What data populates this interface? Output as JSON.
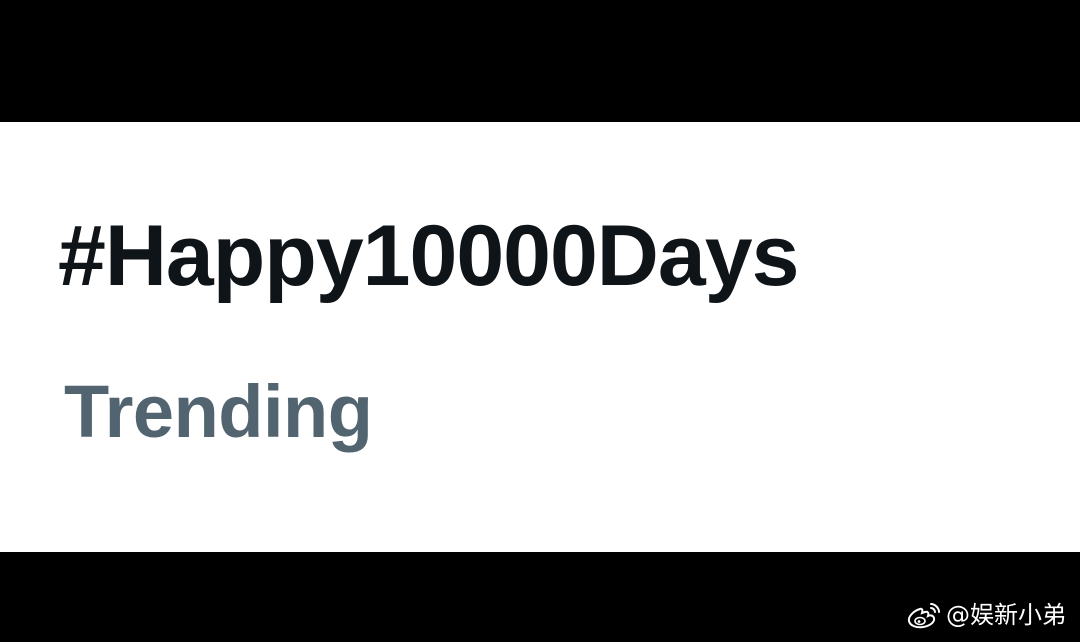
{
  "trend": {
    "hashtag": "#Happy10000Days",
    "context": "Trending"
  },
  "watermark": {
    "icon": "weibo-logo-icon",
    "handle": "@娱新小弟"
  },
  "colors": {
    "letterbox": "#000000",
    "card_background": "#ffffff",
    "hashtag_text": "#0f1419",
    "context_text": "#536471"
  }
}
